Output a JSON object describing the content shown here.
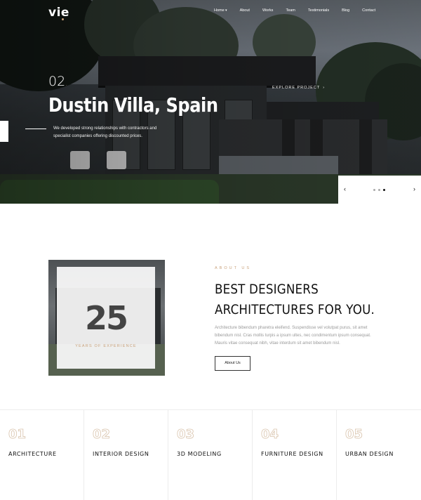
{
  "nav": {
    "logo": "vie",
    "items": [
      "Home",
      "About",
      "Works",
      "Team",
      "Testimonials",
      "Blog",
      "Contact"
    ]
  },
  "hero": {
    "slide_number": "02",
    "title": "Dustin Villa, Spain",
    "description": "We developed strong relationships with contractors and specialist companies offering discounted prices.",
    "explore_label": "EXPLORE PROJECT",
    "slider": {
      "total": 3,
      "active": 3
    }
  },
  "about": {
    "years": "25",
    "years_label": "YEARS OF EXPERIENCE",
    "eyebrow": "ABOUT US",
    "title_line1": "BEST DESIGNERS",
    "title_line2": "ARCHITECTURES FOR YOU.",
    "text": "Architecture bibendum pharetra eleifend. Suspendisse vel volutpat purus, sit amet bibendum nisl. Cras mollis turpis a ipsum ultes, nec condimentum ipsum consequat. Mauris vitae consequat nibh, vitae interdum sit amet bibendum nisl.",
    "button": "About Us"
  },
  "services": [
    {
      "num": "01",
      "name": "ARCHITECTURE"
    },
    {
      "num": "02",
      "name": "INTERIOR DESIGN"
    },
    {
      "num": "03",
      "name": "3D MODELING"
    },
    {
      "num": "04",
      "name": "FURNITURE DESIGN"
    },
    {
      "num": "05",
      "name": "URBAN DESIGN"
    }
  ],
  "colors": {
    "accent": "#c9a27c",
    "dark": "#111111"
  }
}
